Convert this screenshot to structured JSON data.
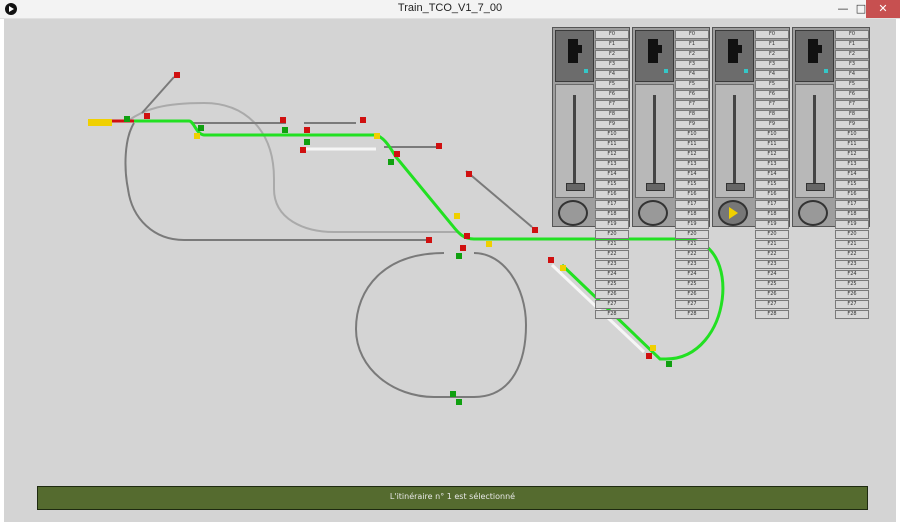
{
  "window": {
    "title": "Train_TCO_V1_7_00",
    "minimize_glyph": "—",
    "maximize_glyph": "□",
    "close_glyph": "✕"
  },
  "status": {
    "message": "L'itinéraire n° 1 est sélectionné"
  },
  "colors": {
    "background": "#d4d4d4",
    "active_route": "#22e022",
    "track": "#7a7a7a",
    "status_bar": "#556b2f",
    "signal_red": "#d01010",
    "signal_green": "#10a010",
    "signal_yellow": "#f0d000"
  },
  "throttles": [
    {
      "id": "throttle-1",
      "dial_state": "stopped",
      "functions": [
        "F0",
        "F1",
        "F2",
        "F3",
        "F4",
        "F5",
        "F6",
        "F7",
        "F8",
        "F9",
        "F10",
        "F11",
        "F12",
        "F13",
        "F14",
        "F15",
        "F16",
        "F17",
        "F18",
        "F19",
        "F20",
        "F21",
        "F22",
        "F23",
        "F24",
        "F25",
        "F26",
        "F27",
        "F28"
      ]
    },
    {
      "id": "throttle-2",
      "dial_state": "stopped",
      "functions": [
        "F0",
        "F1",
        "F2",
        "F3",
        "F4",
        "F5",
        "F6",
        "F7",
        "F8",
        "F9",
        "F10",
        "F11",
        "F12",
        "F13",
        "F14",
        "F15",
        "F16",
        "F17",
        "F18",
        "F19",
        "F20",
        "F21",
        "F22",
        "F23",
        "F24",
        "F25",
        "F26",
        "F27",
        "F28"
      ]
    },
    {
      "id": "throttle-3",
      "dial_state": "forward",
      "functions": [
        "F0",
        "F1",
        "F2",
        "F3",
        "F4",
        "F5",
        "F6",
        "F7",
        "F8",
        "F9",
        "F10",
        "F11",
        "F12",
        "F13",
        "F14",
        "F15",
        "F16",
        "F17",
        "F18",
        "F19",
        "F20",
        "F21",
        "F22",
        "F23",
        "F24",
        "F25",
        "F26",
        "F27",
        "F28"
      ]
    },
    {
      "id": "throttle-4",
      "dial_state": "stopped",
      "functions": [
        "F0",
        "F1",
        "F2",
        "F3",
        "F4",
        "F5",
        "F6",
        "F7",
        "F8",
        "F9",
        "F10",
        "F11",
        "F12",
        "F13",
        "F14",
        "F15",
        "F16",
        "F17",
        "F18",
        "F19",
        "F20",
        "F21",
        "F22",
        "F23",
        "F24",
        "F25",
        "F26",
        "F27",
        "F28"
      ]
    }
  ]
}
